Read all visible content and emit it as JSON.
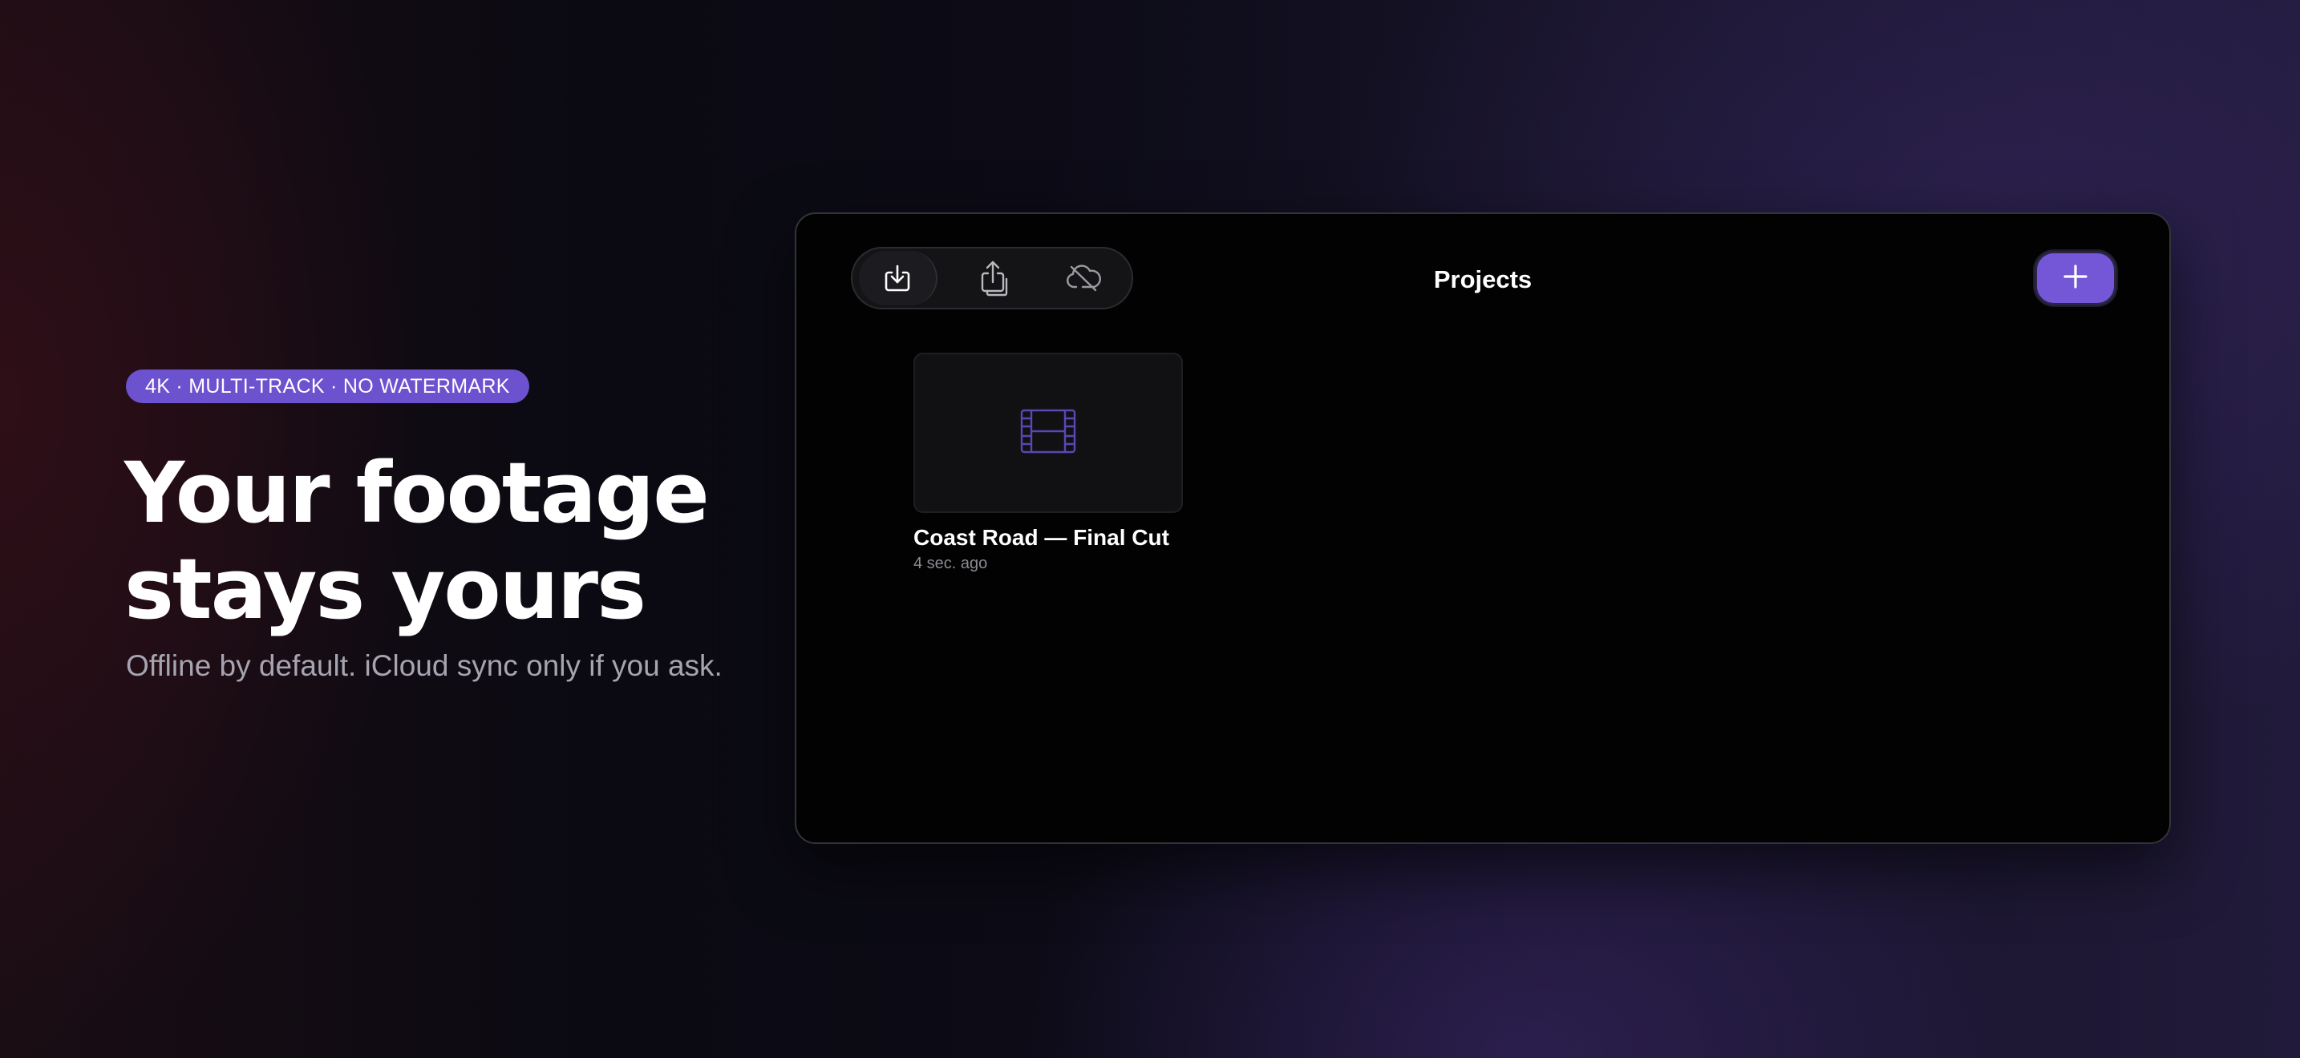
{
  "hero": {
    "badge": "4K · MULTI-TRACK · NO WATERMARK",
    "headline": "Your footage stays yours",
    "subline": "Offline by default. iCloud sync only if you ask."
  },
  "app": {
    "title": "Projects",
    "toolbar": {
      "buttons": [
        {
          "icon": "import-icon",
          "active": true
        },
        {
          "icon": "share-icon",
          "active": false
        },
        {
          "icon": "cloud-off-icon",
          "active": false
        }
      ]
    },
    "add_button": {
      "icon": "plus-icon"
    },
    "projects": [
      {
        "name": "Coast Road — Final Cut",
        "modified": "4 sec. ago",
        "thumbnail_icon": "film-icon"
      }
    ]
  },
  "colors": {
    "accent": "#7457d6",
    "badge": "#6d52cf",
    "window_bg": "#020202",
    "text_secondary": "#a7a4b2"
  }
}
